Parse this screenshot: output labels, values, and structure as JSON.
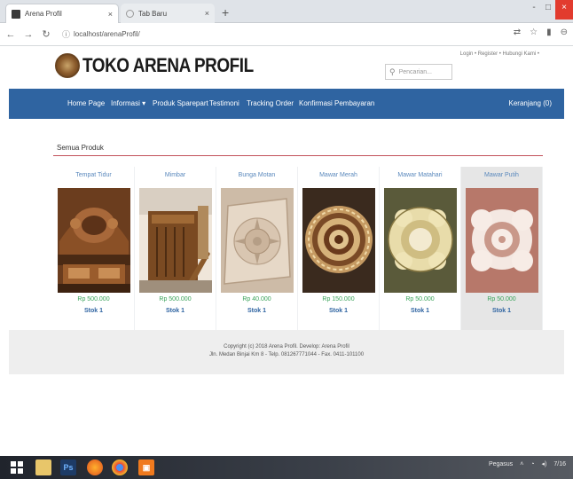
{
  "browser": {
    "tabs": [
      {
        "title": "Arena Profil"
      },
      {
        "title": "Tab Baru"
      }
    ],
    "url": "localhost/arenaProfil/",
    "window_controls": [
      "-",
      "□",
      "×"
    ]
  },
  "header": {
    "logo_text": "TOKO ARENA PROFIL",
    "top_links": "Login • Register • Hubungi Kami •",
    "search_placeholder": "Pencarian..."
  },
  "nav": {
    "items": [
      {
        "label": "Home Page"
      },
      {
        "label": "Informasi ▾"
      },
      {
        "label": "Produk Sparepart"
      },
      {
        "label": "Testimoni"
      },
      {
        "label": "Tracking Order"
      },
      {
        "label": "Konfirmasi Pembayaran"
      }
    ],
    "cart_label": "Keranjang (0)"
  },
  "main": {
    "section_title": "Semua Produk",
    "products": [
      {
        "name": "Tempat Tidur",
        "price": "Rp 500.000",
        "stock": "Stok 1"
      },
      {
        "name": "Mimbar",
        "price": "Rp 500.000",
        "stock": "Stok 1"
      },
      {
        "name": "Bunga Motan",
        "price": "Rp 40.000",
        "stock": "Stok 1"
      },
      {
        "name": "Mawar Merah",
        "price": "Rp 150.000",
        "stock": "Stok 1"
      },
      {
        "name": "Mawar Matahari",
        "price": "Rp 50.000",
        "stock": "Stok 1"
      },
      {
        "name": "Mawar Putih",
        "price": "Rp 50.000",
        "stock": "Stok 1"
      }
    ]
  },
  "footer": {
    "line1": "Copyright (c) 2018 Arena Profil. Develop: Arena Profil",
    "line2": "Jln. Medan Binjai Km 8 - Telp. 081267771044 - Fax. 0411-101100"
  },
  "taskbar": {
    "tray_text": "Pegasus",
    "clock": "7/16"
  }
}
